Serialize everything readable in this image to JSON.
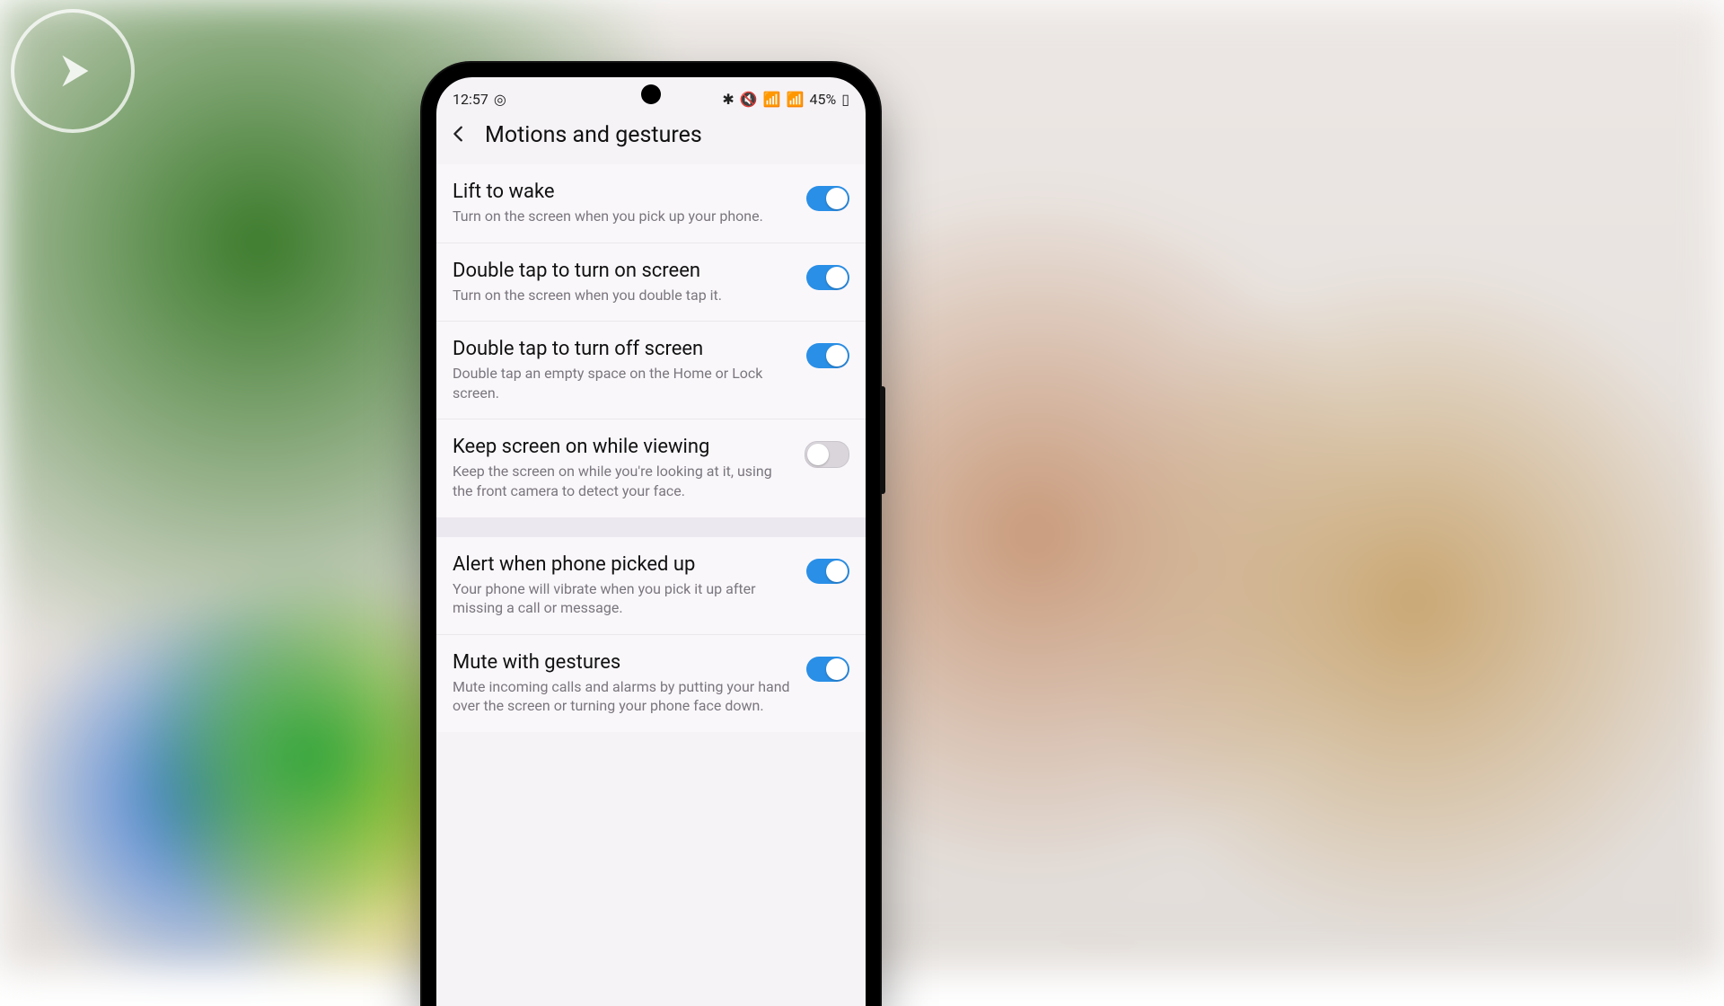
{
  "status": {
    "time": "12:57",
    "clock_glyph": "◎",
    "bt_glyph": "✱",
    "mute_glyph": "🔇",
    "wifi_glyph": "📶",
    "signal_glyph": "📶",
    "battery_pct": "45%",
    "battery_glyph": "▯"
  },
  "header": {
    "title": "Motions and gestures",
    "back_glyph": "‹"
  },
  "items": [
    {
      "title": "Lift to wake",
      "desc": "Turn on the screen when you pick up your phone.",
      "on": true
    },
    {
      "title": "Double tap to turn on screen",
      "desc": "Turn on the screen when you double tap it.",
      "on": true
    },
    {
      "title": "Double tap to turn off screen",
      "desc": "Double tap an empty space on the Home or Lock screen.",
      "on": true
    },
    {
      "title": "Keep screen on while viewing",
      "desc": "Keep the screen on while you're looking at it, using the front camera to detect your face.",
      "on": false
    }
  ],
  "items2": [
    {
      "title": "Alert when phone picked up",
      "desc": "Your phone will vibrate when you pick it up after missing a call or message.",
      "on": true
    },
    {
      "title": "Mute with gestures",
      "desc": "Mute incoming calls and alarms by putting your hand over the screen or turning your phone face down.",
      "on": true
    }
  ]
}
